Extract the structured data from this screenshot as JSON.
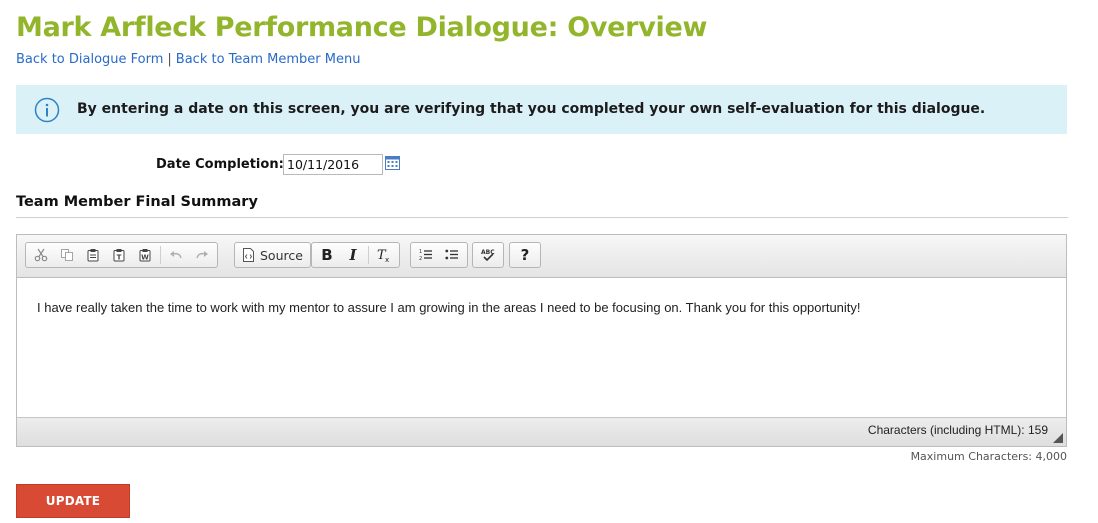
{
  "page": {
    "title": "Mark Arfleck Performance Dialogue: Overview"
  },
  "breadcrumb": {
    "link1": "Back to Dialogue Form",
    "separator": "|",
    "link2": "Back to Team Member Menu"
  },
  "info_banner": {
    "icon": "info-icon",
    "text": "By entering a date on this screen, you are verifying that you completed your own self-evaluation for this dialogue."
  },
  "date_completion": {
    "label": "Date Completion:",
    "value": "10/11/2016",
    "icon": "calendar-icon"
  },
  "summary": {
    "title": "Team Member Final Summary"
  },
  "editor": {
    "toolbar": {
      "groups": [
        [
          "cut-icon",
          "copy-icon",
          "paste-icon",
          "paste-text-icon",
          "paste-word-icon",
          "undo-icon",
          "redo-icon"
        ],
        [
          "source-icon"
        ],
        [
          "bold-icon",
          "italic-icon",
          "remove-format-icon"
        ],
        [
          "numbered-list-icon",
          "bulleted-list-icon"
        ],
        [
          "spellcheck-icon"
        ],
        [
          "help-icon"
        ]
      ],
      "source_label": "Source",
      "bold_glyph": "B",
      "italic_glyph": "I",
      "help_glyph": "?"
    },
    "content": "I have really taken the time to work with my mentor to assure I am growing in the areas I need to be focusing on.  Thank you for this opportunity!",
    "char_count_label": "Characters (including HTML): 159"
  },
  "max_chars_label": "Maximum Characters: 4,000",
  "update_button": {
    "label": "UPDATE"
  },
  "colors": {
    "title": "#92b52b",
    "link": "#2a6ac7",
    "banner_bg": "#dbf1f8",
    "info_icon": "#2d83c4",
    "button_bg": "#d94a34"
  }
}
